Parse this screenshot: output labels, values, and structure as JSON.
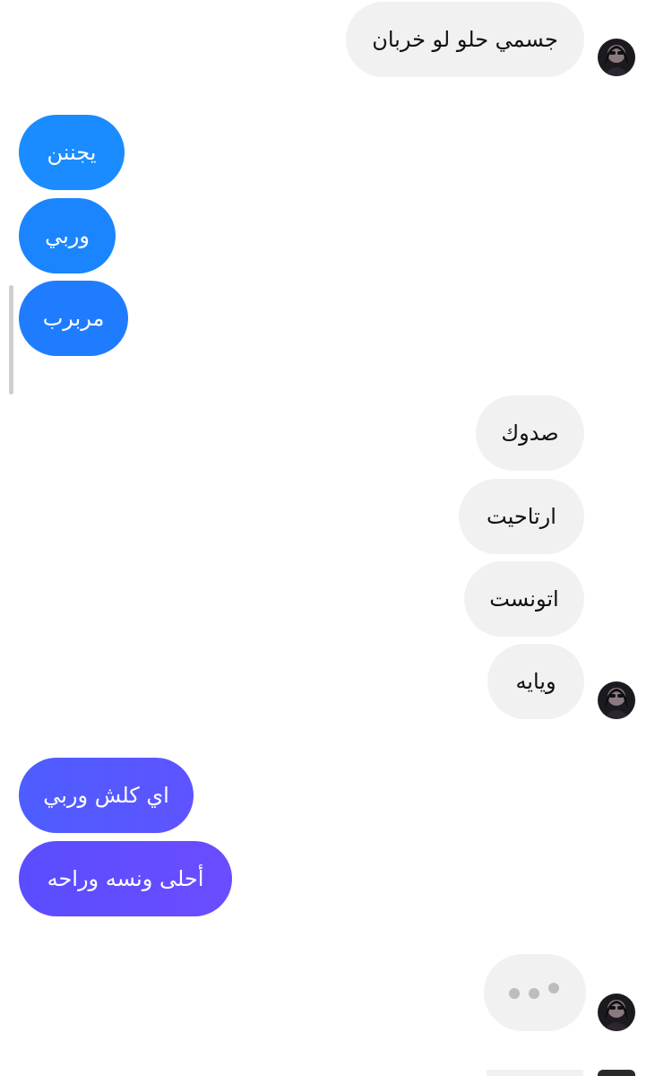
{
  "messages": {
    "incoming_1": "جسمي حلو لو خربان",
    "outgoing_1": "يجننن",
    "outgoing_2": "وربي",
    "outgoing_3": "مربرب",
    "incoming_2": "صدوك",
    "incoming_3": "ارتاحيت",
    "incoming_4": "اتونست",
    "incoming_5": "ويايه",
    "outgoing_4": "اي كلش وربي",
    "outgoing_5": "أحلى ونسه وراحه"
  },
  "colors": {
    "incoming_bg": "#f1f1f1",
    "outgoing_blue": "#1a8cff",
    "outgoing_purple": "#6a4dff"
  },
  "icons": {
    "avatar": "profile-photo",
    "typing": "typing-indicator"
  }
}
